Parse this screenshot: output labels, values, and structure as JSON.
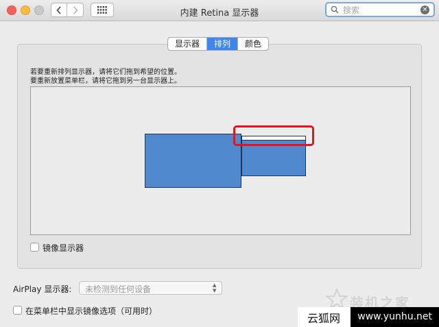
{
  "window": {
    "title": "内建 Retina 显示器",
    "search_placeholder": "搜索"
  },
  "tabs": [
    {
      "label": "显示器",
      "active": false
    },
    {
      "label": "排列",
      "active": true
    },
    {
      "label": "颜色",
      "active": false
    }
  ],
  "arrangement": {
    "instruction_1": "若要重新排列显示器，请将它们拖到希望的位置。",
    "instruction_2": "要重新放置菜单栏，请将它拖到另一台显示器上。",
    "mirror_label": "镜像显示器",
    "mirror_checked": false
  },
  "airplay": {
    "label": "AirPlay 显示器:",
    "value": "未检测到任何设备"
  },
  "menubar_option": {
    "label": "在菜单栏中显示镜像选项（可用时）",
    "checked": false
  },
  "watermark": {
    "text": "装机之家",
    "cn": "云狐网",
    "url": "www.yunhu.net"
  },
  "colors": {
    "accent": "#3b86f2",
    "display_fill": "#5189cf",
    "highlight": "#e3141e"
  }
}
